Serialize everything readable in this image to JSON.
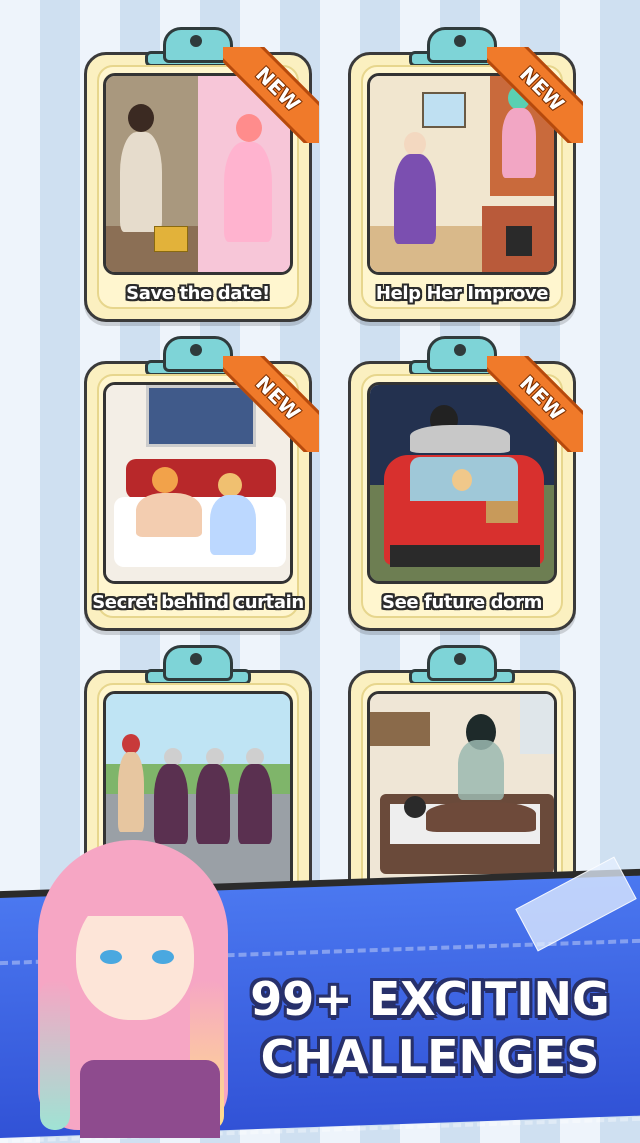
{
  "cards": [
    {
      "label": "Save the date!",
      "badge": "NEW"
    },
    {
      "label": "Help Her Improve",
      "badge": "NEW"
    },
    {
      "label": "Secret behind curtain",
      "badge": "NEW"
    },
    {
      "label": "See future dorm",
      "badge": "NEW"
    },
    {
      "label": "",
      "badge": ""
    },
    {
      "label": "",
      "badge": ""
    }
  ],
  "banner": {
    "line1": "99+ EXCITING",
    "line2": "CHALLENGES"
  },
  "colors": {
    "card_bg": "#fbf0c0",
    "clip": "#7ed4d7",
    "badge": "#f07a2a",
    "banner": "#3a5fe0"
  }
}
